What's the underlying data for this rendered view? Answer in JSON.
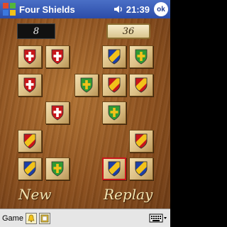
{
  "titlebar": {
    "app_title": "Four Shields",
    "time": "21:39",
    "ok_label": "ok"
  },
  "scores": {
    "left": "8",
    "right": "36"
  },
  "labels": {
    "new": "New",
    "replay": "Replay"
  },
  "menubar": {
    "game_label": "Game"
  },
  "colors": {
    "red": "#c8161a",
    "yellow": "#f2c21a",
    "blue": "#1c3fa8",
    "green": "#2f9a34",
    "white": "#ffffff"
  },
  "tiles": [
    {
      "row": 1,
      "col": 1,
      "shield": "red-white-cross"
    },
    {
      "row": 1,
      "col": 2,
      "shield": "red-white-cross"
    },
    {
      "row": 1,
      "col": 5,
      "shield": "blue-yellow-bend"
    },
    {
      "row": 1,
      "col": 6,
      "shield": "green-yellow-cross"
    },
    {
      "row": 2,
      "col": 1,
      "shield": "red-white-cross"
    },
    {
      "row": 2,
      "col": 4,
      "shield": "green-yellow-cross"
    },
    {
      "row": 2,
      "col": 5,
      "shield": "red-yellow-bend"
    },
    {
      "row": 2,
      "col": 6,
      "shield": "red-yellow-bend"
    },
    {
      "row": 3,
      "col": 3,
      "shield": "red-white-cross"
    },
    {
      "row": 3,
      "col": 5,
      "shield": "green-yellow-cross"
    },
    {
      "row": 4,
      "col": 1,
      "shield": "red-yellow-bend"
    },
    {
      "row": 4,
      "col": 6,
      "shield": "red-yellow-bend"
    },
    {
      "row": 5,
      "col": 1,
      "shield": "blue-yellow-bend"
    },
    {
      "row": 5,
      "col": 2,
      "shield": "green-yellow-cross"
    },
    {
      "row": 5,
      "col": 5,
      "shield": "blue-yellow-bend",
      "selected": true
    },
    {
      "row": 5,
      "col": 6,
      "shield": "blue-yellow-bend"
    }
  ]
}
